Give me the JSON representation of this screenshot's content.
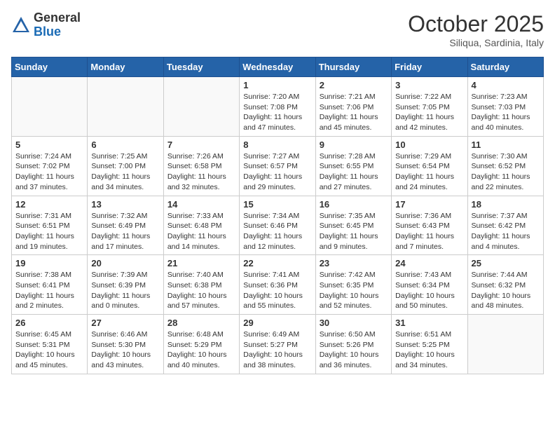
{
  "header": {
    "logo_line1": "General",
    "logo_line2": "Blue",
    "month": "October 2025",
    "location": "Siliqua, Sardinia, Italy"
  },
  "weekdays": [
    "Sunday",
    "Monday",
    "Tuesday",
    "Wednesday",
    "Thursday",
    "Friday",
    "Saturday"
  ],
  "weeks": [
    [
      {
        "day": "",
        "info": ""
      },
      {
        "day": "",
        "info": ""
      },
      {
        "day": "",
        "info": ""
      },
      {
        "day": "1",
        "info": "Sunrise: 7:20 AM\nSunset: 7:08 PM\nDaylight: 11 hours and 47 minutes."
      },
      {
        "day": "2",
        "info": "Sunrise: 7:21 AM\nSunset: 7:06 PM\nDaylight: 11 hours and 45 minutes."
      },
      {
        "day": "3",
        "info": "Sunrise: 7:22 AM\nSunset: 7:05 PM\nDaylight: 11 hours and 42 minutes."
      },
      {
        "day": "4",
        "info": "Sunrise: 7:23 AM\nSunset: 7:03 PM\nDaylight: 11 hours and 40 minutes."
      }
    ],
    [
      {
        "day": "5",
        "info": "Sunrise: 7:24 AM\nSunset: 7:02 PM\nDaylight: 11 hours and 37 minutes."
      },
      {
        "day": "6",
        "info": "Sunrise: 7:25 AM\nSunset: 7:00 PM\nDaylight: 11 hours and 34 minutes."
      },
      {
        "day": "7",
        "info": "Sunrise: 7:26 AM\nSunset: 6:58 PM\nDaylight: 11 hours and 32 minutes."
      },
      {
        "day": "8",
        "info": "Sunrise: 7:27 AM\nSunset: 6:57 PM\nDaylight: 11 hours and 29 minutes."
      },
      {
        "day": "9",
        "info": "Sunrise: 7:28 AM\nSunset: 6:55 PM\nDaylight: 11 hours and 27 minutes."
      },
      {
        "day": "10",
        "info": "Sunrise: 7:29 AM\nSunset: 6:54 PM\nDaylight: 11 hours and 24 minutes."
      },
      {
        "day": "11",
        "info": "Sunrise: 7:30 AM\nSunset: 6:52 PM\nDaylight: 11 hours and 22 minutes."
      }
    ],
    [
      {
        "day": "12",
        "info": "Sunrise: 7:31 AM\nSunset: 6:51 PM\nDaylight: 11 hours and 19 minutes."
      },
      {
        "day": "13",
        "info": "Sunrise: 7:32 AM\nSunset: 6:49 PM\nDaylight: 11 hours and 17 minutes."
      },
      {
        "day": "14",
        "info": "Sunrise: 7:33 AM\nSunset: 6:48 PM\nDaylight: 11 hours and 14 minutes."
      },
      {
        "day": "15",
        "info": "Sunrise: 7:34 AM\nSunset: 6:46 PM\nDaylight: 11 hours and 12 minutes."
      },
      {
        "day": "16",
        "info": "Sunrise: 7:35 AM\nSunset: 6:45 PM\nDaylight: 11 hours and 9 minutes."
      },
      {
        "day": "17",
        "info": "Sunrise: 7:36 AM\nSunset: 6:43 PM\nDaylight: 11 hours and 7 minutes."
      },
      {
        "day": "18",
        "info": "Sunrise: 7:37 AM\nSunset: 6:42 PM\nDaylight: 11 hours and 4 minutes."
      }
    ],
    [
      {
        "day": "19",
        "info": "Sunrise: 7:38 AM\nSunset: 6:41 PM\nDaylight: 11 hours and 2 minutes."
      },
      {
        "day": "20",
        "info": "Sunrise: 7:39 AM\nSunset: 6:39 PM\nDaylight: 11 hours and 0 minutes."
      },
      {
        "day": "21",
        "info": "Sunrise: 7:40 AM\nSunset: 6:38 PM\nDaylight: 10 hours and 57 minutes."
      },
      {
        "day": "22",
        "info": "Sunrise: 7:41 AM\nSunset: 6:36 PM\nDaylight: 10 hours and 55 minutes."
      },
      {
        "day": "23",
        "info": "Sunrise: 7:42 AM\nSunset: 6:35 PM\nDaylight: 10 hours and 52 minutes."
      },
      {
        "day": "24",
        "info": "Sunrise: 7:43 AM\nSunset: 6:34 PM\nDaylight: 10 hours and 50 minutes."
      },
      {
        "day": "25",
        "info": "Sunrise: 7:44 AM\nSunset: 6:32 PM\nDaylight: 10 hours and 48 minutes."
      }
    ],
    [
      {
        "day": "26",
        "info": "Sunrise: 6:45 AM\nSunset: 5:31 PM\nDaylight: 10 hours and 45 minutes."
      },
      {
        "day": "27",
        "info": "Sunrise: 6:46 AM\nSunset: 5:30 PM\nDaylight: 10 hours and 43 minutes."
      },
      {
        "day": "28",
        "info": "Sunrise: 6:48 AM\nSunset: 5:29 PM\nDaylight: 10 hours and 40 minutes."
      },
      {
        "day": "29",
        "info": "Sunrise: 6:49 AM\nSunset: 5:27 PM\nDaylight: 10 hours and 38 minutes."
      },
      {
        "day": "30",
        "info": "Sunrise: 6:50 AM\nSunset: 5:26 PM\nDaylight: 10 hours and 36 minutes."
      },
      {
        "day": "31",
        "info": "Sunrise: 6:51 AM\nSunset: 5:25 PM\nDaylight: 10 hours and 34 minutes."
      },
      {
        "day": "",
        "info": ""
      }
    ]
  ]
}
